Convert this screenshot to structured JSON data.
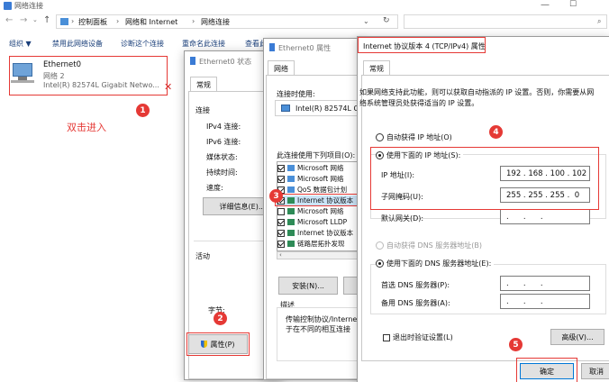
{
  "explorer": {
    "title": "网络连接",
    "breadcrumb": [
      "控制面板",
      "网络和 Internet",
      "网络连接"
    ],
    "toolbar": [
      "组织 ▼",
      "禁用此网络设备",
      "诊断这个连接",
      "重命名此连接",
      "查看此"
    ],
    "adapter": {
      "name": "Ethernet0",
      "network": "网络 2",
      "device": "Intel(R) 82574L Gigabit Netwo..."
    },
    "annotation": "双击进入",
    "search_icon": "search-icon"
  },
  "status": {
    "title": "Ethernet0 状态",
    "tab": "常规",
    "connection_header": "连接",
    "rows": [
      "IPv4 连接:",
      "IPv6 连接:",
      "媒体状态:",
      "持续时间:",
      "速度:"
    ],
    "details_btn": "详细信息(E)...",
    "activity": "活动",
    "bytes": "字节:",
    "properties_btn": "属性(P)"
  },
  "props": {
    "title": "Ethernet0 属性",
    "tab": "网络",
    "connect_using": "连接时使用:",
    "adapter": "Intel(R) 82574L G",
    "items_label": "此连接使用下列项目(O):",
    "items": [
      {
        "label": "Microsoft 网络",
        "checked": true
      },
      {
        "label": "Microsoft 网络",
        "checked": true
      },
      {
        "label": "QoS 数据包计划",
        "checked": true
      },
      {
        "label": "Internet 协议版本",
        "checked": true
      },
      {
        "label": "Microsoft 网络",
        "checked": false
      },
      {
        "label": "Microsoft LLDP",
        "checked": true
      },
      {
        "label": "Internet 协议版本",
        "checked": true
      },
      {
        "label": "链路层拓扑发现",
        "checked": true
      }
    ],
    "install_btn": "安装(N)...",
    "desc_label": "描述",
    "desc_text1": "传输控制协议/Interne",
    "desc_text2": "于在不同的相互连接"
  },
  "ipv4": {
    "title": "Internet 协议版本 4 (TCP/IPv4) 属性",
    "tab": "常规",
    "intro1": "如果网络支持此功能，则可以获取自动指派的 IP 设置。否则，你需要从网",
    "intro2": "络系统管理员处获得适当的 IP 设置。",
    "auto_ip": "自动获得 IP 地址(O)",
    "manual_ip": "使用下面的 IP 地址(S):",
    "ip_label": "IP 地址(I):",
    "ip_value": "192 . 168 . 100 . 102",
    "mask_label": "子网掩码(U):",
    "mask_value": "255 . 255 . 255 .  0",
    "gateway_label": "默认网关(D):",
    "empty_ip": ".      .      .",
    "auto_dns": "自动获得 DNS 服务器地址(B)",
    "manual_dns": "使用下面的 DNS 服务器地址(E):",
    "dns1_label": "首选 DNS 服务器(P):",
    "dns2_label": "备用 DNS 服务器(A):",
    "validate": "退出时验证设置(L)",
    "advanced_btn": "高级(V)...",
    "ok_btn": "确定",
    "cancel_btn": "取消"
  },
  "badges": [
    "1",
    "2",
    "3",
    "4",
    "5"
  ],
  "colors": {
    "annotation": "#e53935",
    "link_blue": "#1a5fb4"
  }
}
